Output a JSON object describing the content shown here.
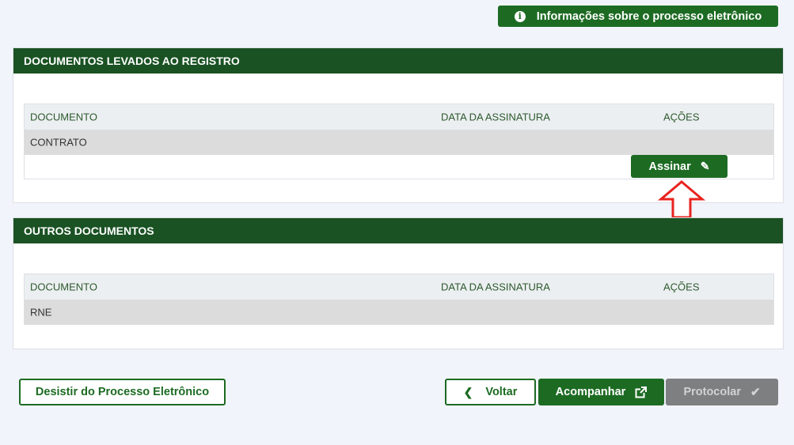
{
  "top": {
    "info_label": "Informações sobre o processo eletrônico",
    "info_icon": "info-icon"
  },
  "registro": {
    "title": "DOCUMENTOS LEVADOS AO REGISTRO",
    "columns": [
      "DOCUMENTO",
      "DATA DA ASSINATURA",
      "AÇÕES"
    ],
    "rows": [
      {
        "documento": "CONTRATO",
        "data": "",
        "acoes": ""
      }
    ],
    "sign_label": "Assinar",
    "sign_icon": "pencil-icon"
  },
  "outros": {
    "title": "OUTROS DOCUMENTOS",
    "columns": [
      "DOCUMENTO",
      "DATA DA ASSINATURA",
      "AÇÕES"
    ],
    "rows": [
      {
        "documento": "RNE",
        "data": "",
        "acoes": ""
      }
    ]
  },
  "footer": {
    "desistir_label": "Desistir do Processo Eletrônico",
    "voltar_label": "Voltar",
    "acompanhar_label": "Acompanhar",
    "protocolar_label": "Protocolar"
  },
  "colors": {
    "primary_green": "#1d6b23",
    "header_green": "#1a5223",
    "disabled_grey": "#7d7f80",
    "annotation_red": "#e8231f"
  }
}
